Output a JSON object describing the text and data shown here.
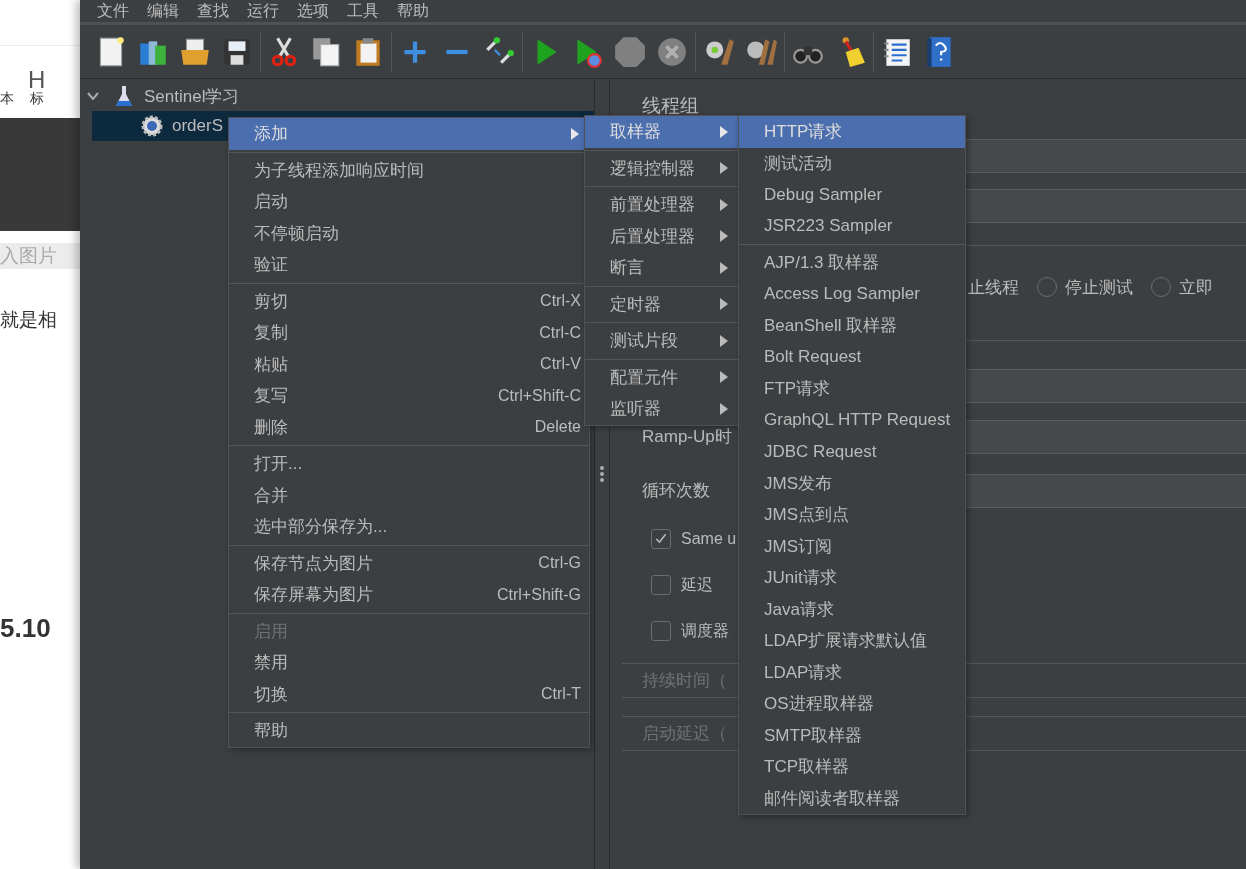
{
  "background_page": {
    "texts": [
      {
        "kind": "toolbar",
        "label": "本"
      },
      {
        "kind": "heading_icon",
        "label": "H"
      },
      {
        "kind": "toolbar",
        "label": "标"
      },
      {
        "kind": "hint",
        "label": "入图片"
      },
      {
        "kind": "body",
        "label": "就是相"
      },
      {
        "kind": "version",
        "label": "5.10"
      }
    ]
  },
  "menu_bar": [
    "文件",
    "编辑",
    "查找",
    "运行",
    "选项",
    "工具",
    "帮助"
  ],
  "toolbar": [
    {
      "kind": "new",
      "disabled": false
    },
    {
      "kind": "templates",
      "disabled": false
    },
    {
      "kind": "open",
      "disabled": false
    },
    {
      "kind": "save",
      "disabled": false
    },
    {
      "kind": "separator"
    },
    {
      "kind": "cut",
      "disabled": false
    },
    {
      "kind": "copy",
      "disabled": false
    },
    {
      "kind": "paste",
      "disabled": false
    },
    {
      "kind": "separator"
    },
    {
      "kind": "expand",
      "disabled": false
    },
    {
      "kind": "collapse",
      "disabled": false
    },
    {
      "kind": "toggle",
      "disabled": false
    },
    {
      "kind": "separator"
    },
    {
      "kind": "start",
      "disabled": false
    },
    {
      "kind": "start_no_pause",
      "disabled": false
    },
    {
      "kind": "stop",
      "disabled": true
    },
    {
      "kind": "shutdown",
      "disabled": true
    },
    {
      "kind": "separator"
    },
    {
      "kind": "clear",
      "disabled": false
    },
    {
      "kind": "clear_all",
      "disabled": false
    },
    {
      "kind": "separator"
    },
    {
      "kind": "search",
      "disabled": false
    },
    {
      "kind": "reset_search",
      "disabled": false
    },
    {
      "kind": "separator"
    },
    {
      "kind": "functions",
      "disabled": false
    },
    {
      "kind": "help",
      "disabled": false
    }
  ],
  "tree": [
    {
      "label": "Sentinel学习",
      "kind": "test_plan",
      "expanded": true,
      "selected": false,
      "children": [
        {
          "label": "orderS",
          "kind": "thread_group",
          "selected": true
        }
      ]
    }
  ],
  "thread_group": {
    "title": "线程组",
    "on_error_options": [
      {
        "label": "止线程"
      },
      {
        "label": "停止测试",
        "selected": false
      },
      {
        "label": "立即",
        "selected": false
      }
    ],
    "ramp_up_label": "Ramp-Up时",
    "loop_label": "循环次数",
    "options": [
      {
        "label": "Same u",
        "checked": true
      },
      {
        "label": "延迟",
        "checked": false
      },
      {
        "label": "调度器",
        "checked": false
      }
    ],
    "duration_label": "持续时间（",
    "startup_delay_label": "启动延迟（"
  },
  "menus": [
    {
      "groups": [
        [
          {
            "label": "添加",
            "submenu": true,
            "selected": true,
            "disabled": false
          }
        ],
        [
          {
            "label": "为子线程添加响应时间",
            "submenu": false,
            "selected": false,
            "disabled": false
          },
          {
            "label": "启动",
            "submenu": false,
            "selected": false,
            "disabled": false
          },
          {
            "label": "不停顿启动",
            "submenu": false,
            "selected": false,
            "disabled": false
          },
          {
            "label": "验证",
            "submenu": false,
            "selected": false,
            "disabled": false
          }
        ],
        [
          {
            "label": "剪切",
            "shortcut": "Ctrl-X",
            "submenu": false,
            "selected": false,
            "disabled": false
          },
          {
            "label": "复制",
            "shortcut": "Ctrl-C",
            "submenu": false,
            "selected": false,
            "disabled": false
          },
          {
            "label": "粘贴",
            "shortcut": "Ctrl-V",
            "submenu": false,
            "selected": false,
            "disabled": false
          },
          {
            "label": "复写",
            "shortcut": "Ctrl+Shift-C",
            "submenu": false,
            "selected": false,
            "disabled": false
          },
          {
            "label": "删除",
            "shortcut": "Delete",
            "submenu": false,
            "selected": false,
            "disabled": false
          }
        ],
        [
          {
            "label": "打开...",
            "submenu": false,
            "selected": false,
            "disabled": false
          },
          {
            "label": "合并",
            "submenu": false,
            "selected": false,
            "disabled": false
          },
          {
            "label": "选中部分保存为...",
            "submenu": false,
            "selected": false,
            "disabled": false
          }
        ],
        [
          {
            "label": "保存节点为图片",
            "shortcut": "Ctrl-G",
            "submenu": false,
            "selected": false,
            "disabled": false
          },
          {
            "label": "保存屏幕为图片",
            "shortcut": "Ctrl+Shift-G",
            "submenu": false,
            "selected": false,
            "disabled": false
          }
        ],
        [
          {
            "label": "启用",
            "submenu": false,
            "selected": false,
            "disabled": true
          },
          {
            "label": "禁用",
            "submenu": false,
            "selected": false,
            "disabled": false
          },
          {
            "label": "切换",
            "shortcut": "Ctrl-T",
            "submenu": false,
            "selected": false,
            "disabled": false
          }
        ],
        [
          {
            "label": "帮助",
            "submenu": false,
            "selected": false,
            "disabled": false
          }
        ]
      ]
    },
    {
      "groups": [
        [
          {
            "label": "取样器",
            "submenu": true,
            "selected": true,
            "disabled": false
          }
        ],
        [
          {
            "label": "逻辑控制器",
            "submenu": true,
            "selected": false,
            "disabled": false
          }
        ],
        [
          {
            "label": "前置处理器",
            "submenu": true,
            "selected": false,
            "disabled": false
          },
          {
            "label": "后置处理器",
            "submenu": true,
            "selected": false,
            "disabled": false
          },
          {
            "label": "断言",
            "submenu": true,
            "selected": false,
            "disabled": false
          }
        ],
        [
          {
            "label": "定时器",
            "submenu": true,
            "selected": false,
            "disabled": false
          }
        ],
        [
          {
            "label": "测试片段",
            "submenu": true,
            "selected": false,
            "disabled": false
          }
        ],
        [
          {
            "label": "配置元件",
            "submenu": true,
            "selected": false,
            "disabled": false
          },
          {
            "label": "监听器",
            "submenu": true,
            "selected": false,
            "disabled": false
          }
        ]
      ]
    },
    {
      "groups": [
        [
          {
            "label": "HTTP请求",
            "submenu": false,
            "selected": true,
            "disabled": false
          },
          {
            "label": "测试活动",
            "submenu": false,
            "selected": false,
            "disabled": false
          },
          {
            "label": "Debug Sampler",
            "submenu": false,
            "selected": false,
            "disabled": false
          },
          {
            "label": "JSR223 Sampler",
            "submenu": false,
            "selected": false,
            "disabled": false
          }
        ],
        [
          {
            "label": "AJP/1.3 取样器",
            "submenu": false,
            "selected": false,
            "disabled": false
          },
          {
            "label": "Access Log Sampler",
            "submenu": false,
            "selected": false,
            "disabled": false
          },
          {
            "label": "BeanShell 取样器",
            "submenu": false,
            "selected": false,
            "disabled": false
          },
          {
            "label": "Bolt Request",
            "submenu": false,
            "selected": false,
            "disabled": false
          },
          {
            "label": "FTP请求",
            "submenu": false,
            "selected": false,
            "disabled": false
          },
          {
            "label": "GraphQL HTTP Request",
            "submenu": false,
            "selected": false,
            "disabled": false
          },
          {
            "label": "JDBC Request",
            "submenu": false,
            "selected": false,
            "disabled": false
          },
          {
            "label": "JMS发布",
            "submenu": false,
            "selected": false,
            "disabled": false
          },
          {
            "label": "JMS点到点",
            "submenu": false,
            "selected": false,
            "disabled": false
          },
          {
            "label": "JMS订阅",
            "submenu": false,
            "selected": false,
            "disabled": false
          },
          {
            "label": "JUnit请求",
            "submenu": false,
            "selected": false,
            "disabled": false
          },
          {
            "label": "Java请求",
            "submenu": false,
            "selected": false,
            "disabled": false
          },
          {
            "label": "LDAP扩展请求默认值",
            "submenu": false,
            "selected": false,
            "disabled": false
          },
          {
            "label": "LDAP请求",
            "submenu": false,
            "selected": false,
            "disabled": false
          },
          {
            "label": "OS进程取样器",
            "submenu": false,
            "selected": false,
            "disabled": false
          },
          {
            "label": "SMTP取样器",
            "submenu": false,
            "selected": false,
            "disabled": false
          },
          {
            "label": "TCP取样器",
            "submenu": false,
            "selected": false,
            "disabled": false
          },
          {
            "label": "邮件阅读者取样器",
            "submenu": false,
            "selected": false,
            "disabled": false
          }
        ]
      ]
    }
  ]
}
